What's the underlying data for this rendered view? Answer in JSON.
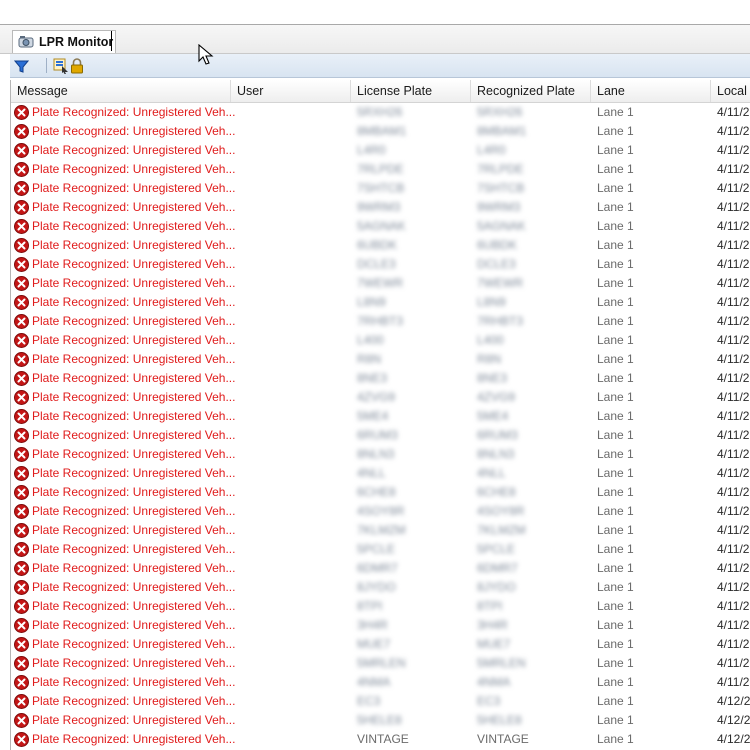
{
  "tab": {
    "label": "LPR Monitor",
    "icon": "lpr-camera-icon"
  },
  "toolbar": {
    "icons": [
      "filter-icon",
      "select-columns-icon",
      "lock-icon"
    ]
  },
  "columns": [
    "Message",
    "User",
    "License Plate",
    "Recognized Plate",
    "Lane",
    "Local T"
  ],
  "rows": [
    {
      "message": "Plate Recognized: Unregistered Veh...",
      "user": "",
      "plate": "5RXH26",
      "recognized": "5RXH26",
      "lane": "Lane 1",
      "time": "4/11/2"
    },
    {
      "message": "Plate Recognized: Unregistered Veh...",
      "user": "",
      "plate": "8MBAM1",
      "recognized": "8MBAM1",
      "lane": "Lane 1",
      "time": "4/11/2"
    },
    {
      "message": "Plate Recognized: Unregistered Veh...",
      "user": "",
      "plate": "L4R0",
      "recognized": "L4R0",
      "lane": "Lane 1",
      "time": "4/11/2"
    },
    {
      "message": "Plate Recognized: Unregistered Veh...",
      "user": "",
      "plate": "7RLPDE",
      "recognized": "7RLPDE",
      "lane": "Lane 1",
      "time": "4/11/2"
    },
    {
      "message": "Plate Recognized: Unregistered Veh...",
      "user": "",
      "plate": "7SHTCB",
      "recognized": "7SHTCB",
      "lane": "Lane 1",
      "time": "4/11/2"
    },
    {
      "message": "Plate Recognized: Unregistered Veh...",
      "user": "",
      "plate": "9WRM3",
      "recognized": "9WRM3",
      "lane": "Lane 1",
      "time": "4/11/2"
    },
    {
      "message": "Plate Recognized: Unregistered Veh...",
      "user": "",
      "plate": "5AGNAK",
      "recognized": "5AGNAK",
      "lane": "Lane 1",
      "time": "4/11/2"
    },
    {
      "message": "Plate Recognized: Unregistered Veh...",
      "user": "",
      "plate": "6UBDK",
      "recognized": "6UBDK",
      "lane": "Lane 1",
      "time": "4/11/2"
    },
    {
      "message": "Plate Recognized: Unregistered Veh...",
      "user": "",
      "plate": "DCLE3",
      "recognized": "DCLE3",
      "lane": "Lane 1",
      "time": "4/11/2"
    },
    {
      "message": "Plate Recognized: Unregistered Veh...",
      "user": "",
      "plate": "7WEWR",
      "recognized": "7WEWR",
      "lane": "Lane 1",
      "time": "4/11/2"
    },
    {
      "message": "Plate Recognized: Unregistered Veh...",
      "user": "",
      "plate": "L8N9",
      "recognized": "L8N9",
      "lane": "Lane 1",
      "time": "4/11/2"
    },
    {
      "message": "Plate Recognized: Unregistered Veh...",
      "user": "",
      "plate": "7RHBT3",
      "recognized": "7RHBT3",
      "lane": "Lane 1",
      "time": "4/11/2"
    },
    {
      "message": "Plate Recognized: Unregistered Veh...",
      "user": "",
      "plate": "L400",
      "recognized": "L400",
      "lane": "Lane 1",
      "time": "4/11/2"
    },
    {
      "message": "Plate Recognized: Unregistered Veh...",
      "user": "",
      "plate": "R8N",
      "recognized": "R8N",
      "lane": "Lane 1",
      "time": "4/11/2"
    },
    {
      "message": "Plate Recognized: Unregistered Veh...",
      "user": "",
      "plate": "8NE3",
      "recognized": "8NE3",
      "lane": "Lane 1",
      "time": "4/11/2"
    },
    {
      "message": "Plate Recognized: Unregistered Veh...",
      "user": "",
      "plate": "4ZVG9",
      "recognized": "4ZVG9",
      "lane": "Lane 1",
      "time": "4/11/2"
    },
    {
      "message": "Plate Recognized: Unregistered Veh...",
      "user": "",
      "plate": "5ME4",
      "recognized": "5ME4",
      "lane": "Lane 1",
      "time": "4/11/2"
    },
    {
      "message": "Plate Recognized: Unregistered Veh...",
      "user": "",
      "plate": "6RUM3",
      "recognized": "6RUM3",
      "lane": "Lane 1",
      "time": "4/11/2"
    },
    {
      "message": "Plate Recognized: Unregistered Veh...",
      "user": "",
      "plate": "8NLN3",
      "recognized": "8NLN3",
      "lane": "Lane 1",
      "time": "4/11/2"
    },
    {
      "message": "Plate Recognized: Unregistered Veh...",
      "user": "",
      "plate": "4NLL",
      "recognized": "4NLL",
      "lane": "Lane 1",
      "time": "4/11/2"
    },
    {
      "message": "Plate Recognized: Unregistered Veh...",
      "user": "",
      "plate": "6CHE8",
      "recognized": "6CHE8",
      "lane": "Lane 1",
      "time": "4/11/2"
    },
    {
      "message": "Plate Recognized: Unregistered Veh...",
      "user": "",
      "plate": "4SOY8R",
      "recognized": "4SOY8R",
      "lane": "Lane 1",
      "time": "4/11/2"
    },
    {
      "message": "Plate Recognized: Unregistered Veh...",
      "user": "",
      "plate": "7KLMZM",
      "recognized": "7KLMZM",
      "lane": "Lane 1",
      "time": "4/11/2"
    },
    {
      "message": "Plate Recognized: Unregistered Veh...",
      "user": "",
      "plate": "5PCLE",
      "recognized": "5PCLE",
      "lane": "Lane 1",
      "time": "4/11/2"
    },
    {
      "message": "Plate Recognized: Unregistered Veh...",
      "user": "",
      "plate": "6DMR7",
      "recognized": "6DMR7",
      "lane": "Lane 1",
      "time": "4/11/2"
    },
    {
      "message": "Plate Recognized: Unregistered Veh...",
      "user": "",
      "plate": "8JYDO",
      "recognized": "8JYDO",
      "lane": "Lane 1",
      "time": "4/11/2"
    },
    {
      "message": "Plate Recognized: Unregistered Veh...",
      "user": "",
      "plate": "8TPI",
      "recognized": "8TPI",
      "lane": "Lane 1",
      "time": "4/11/2"
    },
    {
      "message": "Plate Recognized: Unregistered Veh...",
      "user": "",
      "plate": "3H4R",
      "recognized": "3H4R",
      "lane": "Lane 1",
      "time": "4/11/2"
    },
    {
      "message": "Plate Recognized: Unregistered Veh...",
      "user": "",
      "plate": "MUE7",
      "recognized": "MUE7",
      "lane": "Lane 1",
      "time": "4/11/2"
    },
    {
      "message": "Plate Recognized: Unregistered Veh...",
      "user": "",
      "plate": "5MRLEN",
      "recognized": "5MRLEN",
      "lane": "Lane 1",
      "time": "4/11/2"
    },
    {
      "message": "Plate Recognized: Unregistered Veh...",
      "user": "",
      "plate": "4NMA",
      "recognized": "4NMA",
      "lane": "Lane 1",
      "time": "4/11/2"
    },
    {
      "message": "Plate Recognized: Unregistered Veh...",
      "user": "",
      "plate": "EC3",
      "recognized": "EC3",
      "lane": "Lane 1",
      "time": "4/12/2"
    },
    {
      "message": "Plate Recognized: Unregistered Veh...",
      "user": "",
      "plate": "5HELE8",
      "recognized": "5HELE8",
      "lane": "Lane 1",
      "time": "4/12/2"
    },
    {
      "message": "Plate Recognized: Unregistered Veh...",
      "user": "",
      "plate": "VINTAGE",
      "recognized": "VINTAGE",
      "lane": "Lane 1",
      "time": "4/12/2"
    }
  ],
  "colors": {
    "error_text": "#e01b1b",
    "accent": "#1f5fd0"
  }
}
